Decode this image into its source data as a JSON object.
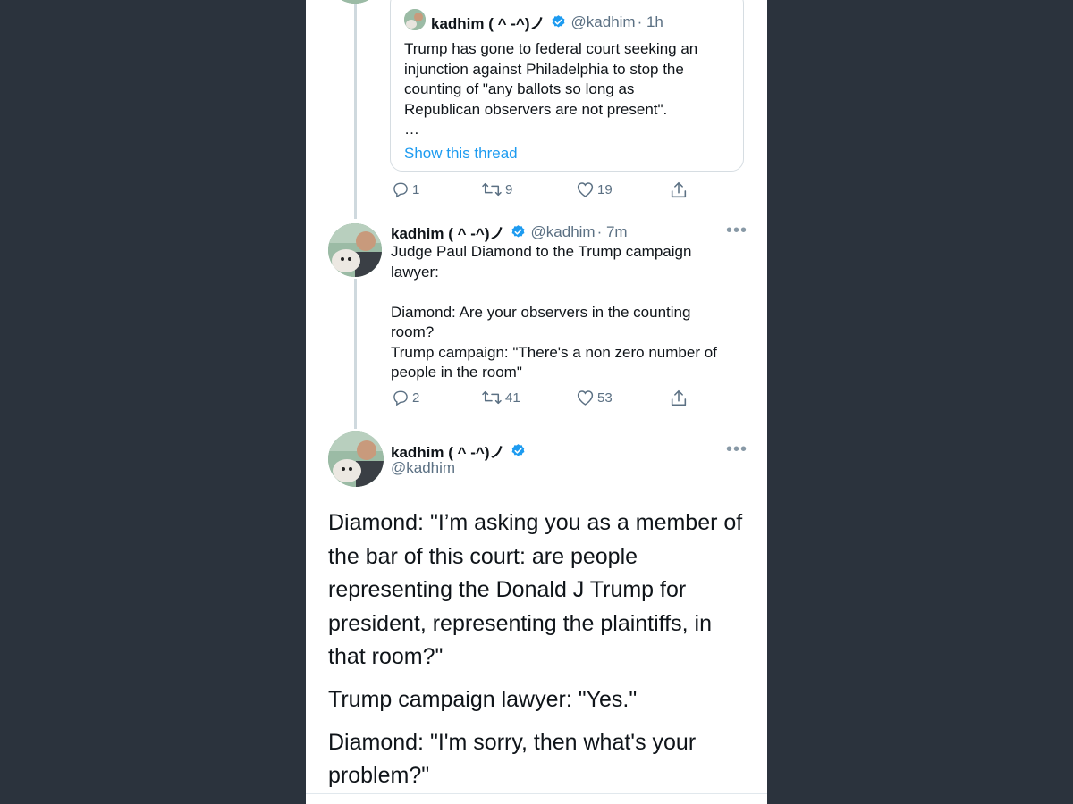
{
  "quoted_tweet": {
    "display_name": "kadhim ( ^ -^)ノ",
    "handle": "@kadhim",
    "time": "· 1h",
    "text": "Trump has gone to federal court seeking an\ninjunction against Philadelphia to stop the\ncounting of \"any ballots so long as\nRepublican observers are not present\".\n…",
    "show_thread": "Show this thread"
  },
  "first_tweet_actions": {
    "replies": "1",
    "retweets": "9",
    "likes": "19"
  },
  "reply_tweet": {
    "display_name": "kadhim ( ^ -^)ノ",
    "handle": "@kadhim",
    "time": "· 7m",
    "text": "Judge Paul Diamond to the Trump campaign\nlawyer:\n\nDiamond: Are your observers in the counting\nroom?\nTrump campaign: \"There's a non zero number of\npeople in the room\"",
    "replies": "2",
    "retweets": "41",
    "likes": "53"
  },
  "main_tweet": {
    "display_name": "kadhim ( ^ -^)ノ",
    "handle": "@kadhim",
    "paragraphs": [
      "Diamond: \"I’m asking you as a member of the bar of this court: are people representing the Donald J Trump for president, representing the plaintiffs, in that room?\"",
      "Trump campaign lawyer: \"Yes.\"",
      "Diamond: \"I'm sorry, then what's your problem?\""
    ]
  },
  "colors": {
    "background": "#2b333d",
    "verified": "#1d9bf0",
    "link": "#1d9bf0",
    "muted": "#5b7083",
    "text": "#0f1419"
  },
  "icons": [
    "reply-icon",
    "retweet-icon",
    "like-icon",
    "share-icon",
    "verified-badge-icon",
    "more-options-icon"
  ]
}
